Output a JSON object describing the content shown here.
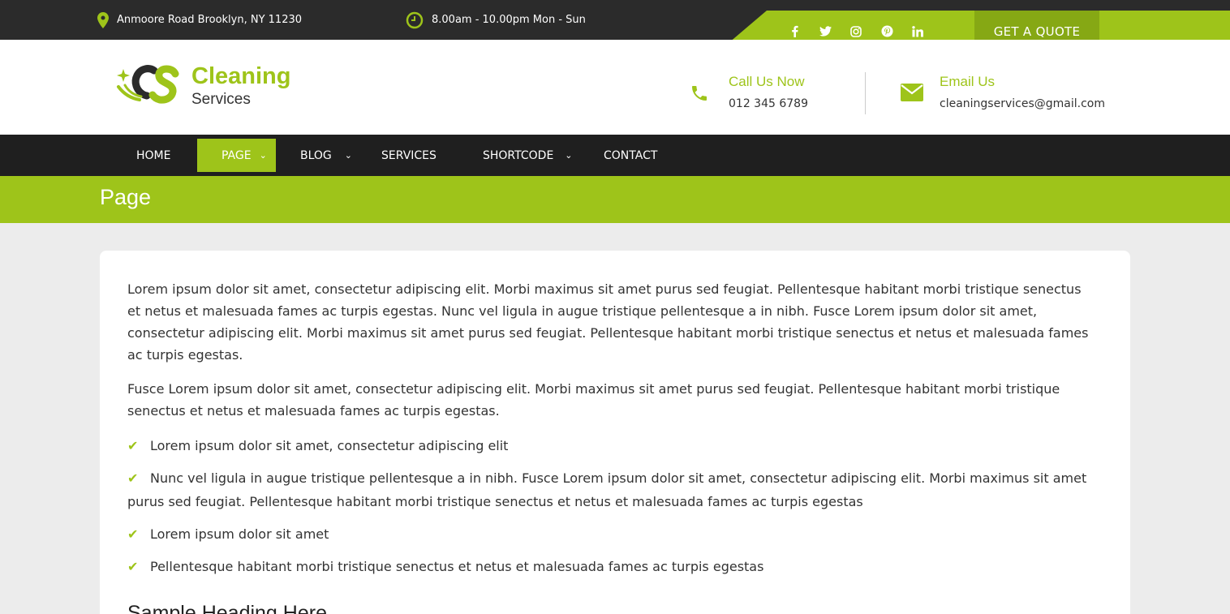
{
  "topbar": {
    "address": "Anmoore Road Brooklyn, NY 11230",
    "hours": "8.00am - 10.00pm Mon - Sun",
    "social": [
      {
        "icon": "facebook-icon",
        "glyph": "f"
      },
      {
        "icon": "twitter-icon",
        "glyph": "t"
      },
      {
        "icon": "instagram-icon",
        "glyph": "i"
      },
      {
        "icon": "pinterest-icon",
        "glyph": "p"
      },
      {
        "icon": "linkedin-icon",
        "glyph": "in"
      }
    ],
    "quote_label": "GET A QUOTE"
  },
  "header": {
    "logo_title": "Cleaning",
    "logo_sub": "Services",
    "phone_title": "Call Us Now",
    "phone_value": "012 345 6789",
    "email_title": "Email Us",
    "email_value": "cleaningservices@gmail.com"
  },
  "nav": {
    "items": [
      {
        "label": "HOME"
      },
      {
        "label": "PAGE"
      },
      {
        "label": "BLOG"
      },
      {
        "label": "SERVICES"
      },
      {
        "label": "SHORTCODE"
      },
      {
        "label": "CONTACT"
      }
    ]
  },
  "banner": {
    "title": "Page"
  },
  "content": {
    "paragraphs": [
      "Lorem ipsum dolor sit amet, consectetur adipiscing elit. Morbi maximus sit amet purus sed feugiat. Pellentesque habitant morbi tristique senectus et netus et malesuada fames ac turpis egestas. Nunc vel ligula in augue tristique pellentesque a in nibh. Fusce Lorem ipsum dolor sit amet, consectetur adipiscing elit. Morbi maximus sit amet purus sed feugiat. Pellentesque habitant morbi tristique senectus et netus et malesuada fames ac turpis egestas.",
      "Fusce Lorem ipsum dolor sit amet, consectetur adipiscing elit. Morbi maximus sit amet purus sed feugiat. Pellentesque habitant morbi tristique senectus et netus et malesuada fames ac turpis egestas."
    ],
    "list": [
      "Lorem ipsum dolor sit amet, consectetur adipiscing elit",
      "Nunc vel ligula in augue tristique pellentesque a in nibh. Fusce Lorem ipsum dolor sit amet, consectetur adipiscing elit. Morbi maximus sit amet purus sed feugiat. Pellentesque habitant morbi tristique senectus et netus et malesuada fames ac turpis egestas",
      "Lorem ipsum dolor sit amet",
      "Pellentesque habitant morbi tristique senectus et netus et malesuada fames ac turpis egestas"
    ],
    "heading": "Sample Heading Here"
  },
  "colors": {
    "accent": "#9ec41a",
    "accent_dark": "#86a814",
    "dark": "#2b2b2b",
    "nav": "#1f1f1f"
  }
}
